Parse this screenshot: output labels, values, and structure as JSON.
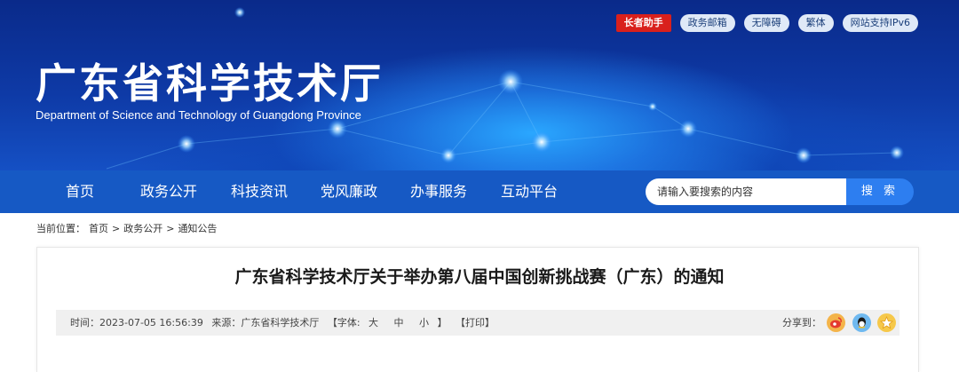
{
  "header": {
    "title": "广东省科学技术厅",
    "subtitle": "Department of Science and Technology of Guangdong Province",
    "top_links": [
      "长者助手",
      "政务邮箱",
      "无障碍",
      "繁体",
      "网站支持IPv6"
    ]
  },
  "nav": {
    "items": [
      "首页",
      "政务公开",
      "科技资讯",
      "党风廉政",
      "办事服务",
      "互动平台"
    ]
  },
  "search": {
    "placeholder": "请输入要搜索的内容",
    "button": "搜 索"
  },
  "breadcrumb": {
    "prefix": "当前位置：",
    "items": [
      "首页",
      "政务公开",
      "通知公告"
    ],
    "separator": ">"
  },
  "article": {
    "title": "广东省科学技术厅关于举办第八届中国创新挑战赛（广东）的通知",
    "time": "时间：2023-07-05 16:56:39",
    "source": "来源：广东省科学技术厅",
    "font_label": "【字体:",
    "font_large": "大",
    "font_medium": "中",
    "font_small": "小",
    "font_close": "】",
    "print": "【打印】",
    "share_label": "分享到："
  },
  "share_icons": [
    "weibo-icon",
    "qq-icon",
    "qzone-icon"
  ],
  "colors": {
    "banner": "#0e3aa6",
    "nav": "#1659c4",
    "search_button": "#2d7ef0",
    "badge_red": "#d9201c"
  }
}
